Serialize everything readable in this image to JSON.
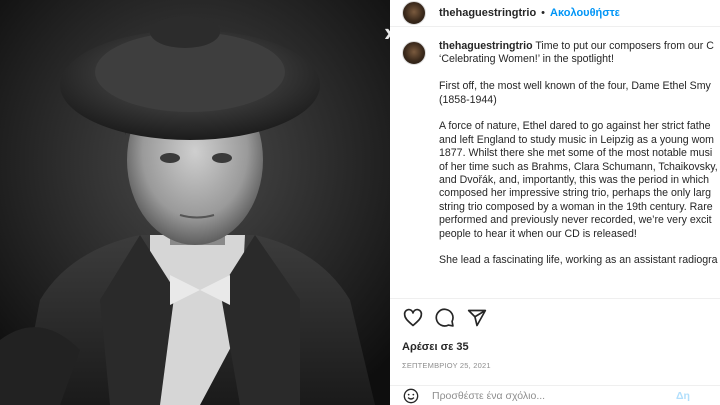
{
  "post": {
    "username": "thehaguestringtrio",
    "follow_label": "Ακολουθήστε",
    "separator": "•",
    "caption_lines": [
      {
        "prefix_user": true,
        "text": " Time to put our composers from our C"
      },
      {
        "text": "‘Celebrating Women!’ in the spotlight!"
      },
      {
        "text": ""
      },
      {
        "text": "First off, the most well known of the four, Dame Ethel Smy"
      },
      {
        "text": "(1858-1944)"
      },
      {
        "text": ""
      },
      {
        "text": "A force of nature, Ethel dared to go against her strict fathe"
      },
      {
        "text": "and left England to study music in Leipzig as a young wom"
      },
      {
        "text": "1877. Whilst there she met some of the most notable musi"
      },
      {
        "text": "of her time such as Brahms, Clara Schumann, Tchaikovsky,"
      },
      {
        "text": "and Dvořák, and, importantly, this was the period in which"
      },
      {
        "text": "composed her impressive string trio, perhaps the only larg"
      },
      {
        "text": "string trio composed by a woman in the 19th century. Rare"
      },
      {
        "text": "performed and previously never recorded, we’re very excit"
      },
      {
        "text": "people to hear it when our CD is released!"
      },
      {
        "text": ""
      },
      {
        "text": "She lead a fascinating life, working as an assistant radiogra"
      }
    ],
    "likes": "Αρέσει σε 35",
    "date": "ΣΕΠΤΕΜΒΡΙΟΥ 25, 2021",
    "comment_placeholder": "Προσθέστε ένα σχόλιο...",
    "post_button": "Δη"
  },
  "icons": {
    "like": "heart-icon",
    "comment": "comment-icon",
    "share": "share-icon",
    "emoji": "emoji-icon"
  },
  "colors": {
    "link_blue": "#0095f6",
    "muted": "#8e8e8e",
    "text": "#262626"
  }
}
